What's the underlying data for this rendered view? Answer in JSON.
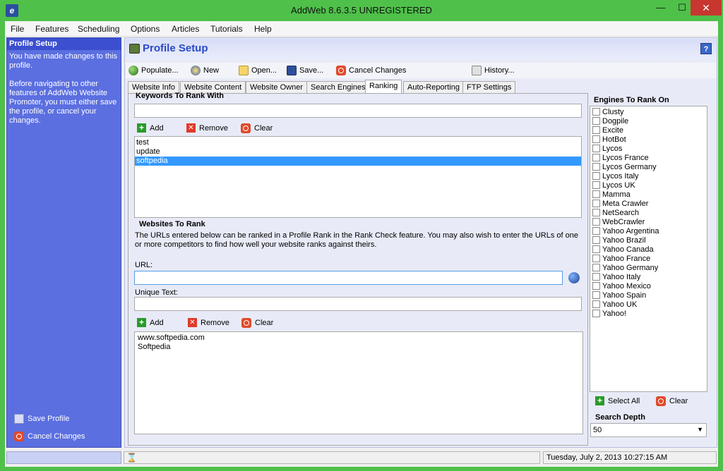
{
  "window": {
    "title": "AddWeb 8.6.3.5  UNREGISTERED",
    "min_label": "—",
    "max_label": "☐",
    "close_label": "✕"
  },
  "menu": [
    "File",
    "Features",
    "Scheduling",
    "Options",
    "Articles",
    "Tutorials",
    "Help"
  ],
  "left_panel": {
    "header": "Profile Setup",
    "message_1": "You have made changes to this profile.",
    "message_2": "Before navigating to other features of AddWeb Website Promoter, you must either save the profile, or cancel your changes.",
    "save_label": "Save Profile",
    "cancel_label": "Cancel Changes"
  },
  "main": {
    "title": "Profile Setup",
    "help_label": "?",
    "toolbar": {
      "populate": "Populate...",
      "new": "New",
      "open": "Open...",
      "save": "Save...",
      "cancel": "Cancel Changes",
      "history": "History..."
    },
    "tabs": [
      "Website Info",
      "Website Content",
      "Website Owner",
      "Search Engines",
      "Ranking",
      "Auto-Reporting",
      "FTP Settings"
    ],
    "active_tab": "Ranking"
  },
  "keywords": {
    "title": "Keywords To Rank With",
    "input_value": "",
    "add": "Add",
    "remove": "Remove",
    "clear": "Clear",
    "items": [
      "test",
      "update",
      "softpedia"
    ],
    "selected_index": 2
  },
  "websites": {
    "title": "Websites To Rank",
    "description": "The URLs entered below can be ranked in a Profile Rank in the Rank Check feature.  You may also wish to enter the URLs of one or more competitors to find how well your website ranks against theirs.",
    "url_label": "URL:",
    "url_value": "",
    "unique_label": "Unique Text:",
    "unique_value": "",
    "add": "Add",
    "remove": "Remove",
    "clear": "Clear",
    "items": [
      "www.softpedia.com",
      "Softpedia"
    ]
  },
  "engines": {
    "title": "Engines To Rank On",
    "items": [
      "Clusty",
      "Dogpile",
      "Excite",
      "HotBot",
      "Lycos",
      "Lycos France",
      "Lycos Germany",
      "Lycos Italy",
      "Lycos UK",
      "Mamma",
      "Meta Crawler",
      "NetSearch",
      "WebCrawler",
      "Yahoo Argentina",
      "Yahoo Brazil",
      "Yahoo Canada",
      "Yahoo France",
      "Yahoo Germany",
      "Yahoo Italy",
      "Yahoo Mexico",
      "Yahoo Spain",
      "Yahoo UK",
      "Yahoo!"
    ],
    "select_all": "Select All",
    "clear": "Clear"
  },
  "search_depth": {
    "label": "Search Depth",
    "value": "50"
  },
  "status": {
    "datetime": "Tuesday, July 2, 2013 10:27:15 AM",
    "hourglass": "⌛"
  },
  "colors": {
    "frame": "#4fc04a",
    "left_panel": "#5b6fe0",
    "accent_title": "#2a49c8",
    "selection": "#3399ff"
  }
}
